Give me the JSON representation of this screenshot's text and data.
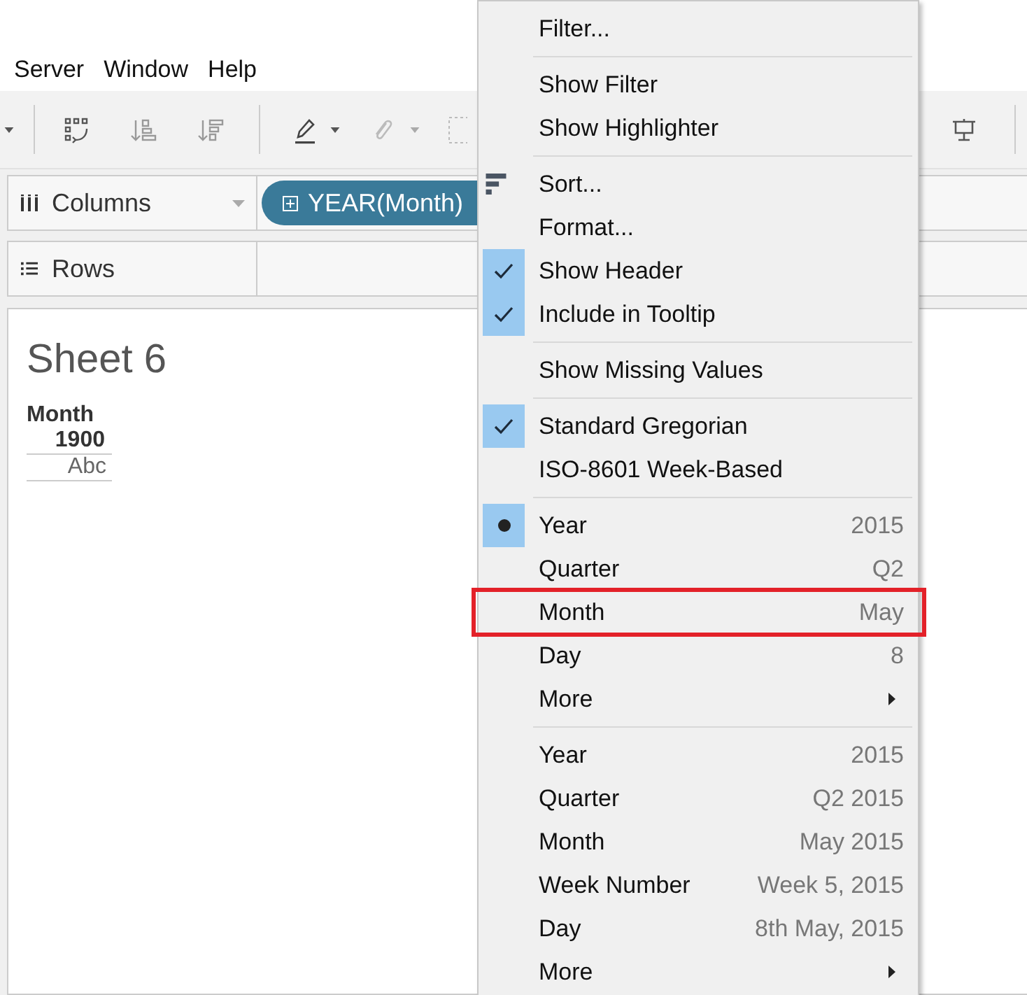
{
  "menu_bar": {
    "items": [
      "Server",
      "Window",
      "Help"
    ]
  },
  "shelves": [
    {
      "kind": "columns",
      "label": "Columns",
      "pill": "YEAR(Month)"
    },
    {
      "kind": "rows",
      "label": "Rows"
    }
  ],
  "sheet": {
    "title": "Sheet 6",
    "header": "Month",
    "year": "1900",
    "cell": "Abc"
  },
  "context_menu": {
    "sections": [
      {
        "items": [
          {
            "kind": "plain",
            "label": "Filter...",
            "checked": false,
            "outlined": false
          }
        ]
      },
      {
        "items": [
          {
            "kind": "plain",
            "label": "Show Filter",
            "checked": false,
            "outlined": false
          },
          {
            "kind": "plain",
            "label": "Show Highlighter",
            "checked": false,
            "outlined": false
          }
        ]
      },
      {
        "items": [
          {
            "kind": "sort",
            "label": "Sort...",
            "checked": false,
            "outlined": false
          },
          {
            "kind": "plain",
            "label": "Format...",
            "checked": false,
            "outlined": false
          },
          {
            "kind": "check",
            "label": "Show Header",
            "checked": true,
            "outlined": false
          },
          {
            "kind": "check",
            "label": "Include in Tooltip",
            "checked": true,
            "outlined": false
          }
        ]
      },
      {
        "items": [
          {
            "kind": "check",
            "label": "Show Missing Values",
            "checked": false,
            "outlined": false
          }
        ]
      },
      {
        "items": [
          {
            "kind": "check",
            "label": "Standard Gregorian",
            "checked": true,
            "outlined": false
          },
          {
            "kind": "check",
            "label": "ISO-8601 Week-Based",
            "checked": false,
            "outlined": false
          }
        ]
      },
      {
        "items": [
          {
            "kind": "radio",
            "label": "Year",
            "value": "2015",
            "checked": true,
            "outlined": false
          },
          {
            "kind": "radio",
            "label": "Quarter",
            "value": "Q2",
            "checked": false,
            "outlined": false
          },
          {
            "kind": "radio",
            "label": "Month",
            "value": "May",
            "checked": false,
            "outlined": true
          },
          {
            "kind": "radio",
            "label": "Day",
            "value": "8",
            "checked": false,
            "outlined": false
          },
          {
            "kind": "submenu",
            "label": "More",
            "checked": false,
            "outlined": false
          }
        ]
      },
      {
        "items": [
          {
            "kind": "radio",
            "label": "Year",
            "value": "2015",
            "checked": false,
            "outlined": false
          },
          {
            "kind": "radio",
            "label": "Quarter",
            "value": "Q2 2015",
            "checked": false,
            "outlined": false
          },
          {
            "kind": "radio",
            "label": "Month",
            "value": "May 2015",
            "checked": false,
            "outlined": false
          },
          {
            "kind": "radio",
            "label": "Week Number",
            "value": "Week 5, 2015",
            "checked": false,
            "outlined": false
          },
          {
            "kind": "radio",
            "label": "Day",
            "value": "8th May, 2015",
            "checked": false,
            "outlined": false
          },
          {
            "kind": "submenu",
            "label": "More",
            "checked": false,
            "outlined": false
          }
        ]
      }
    ]
  }
}
